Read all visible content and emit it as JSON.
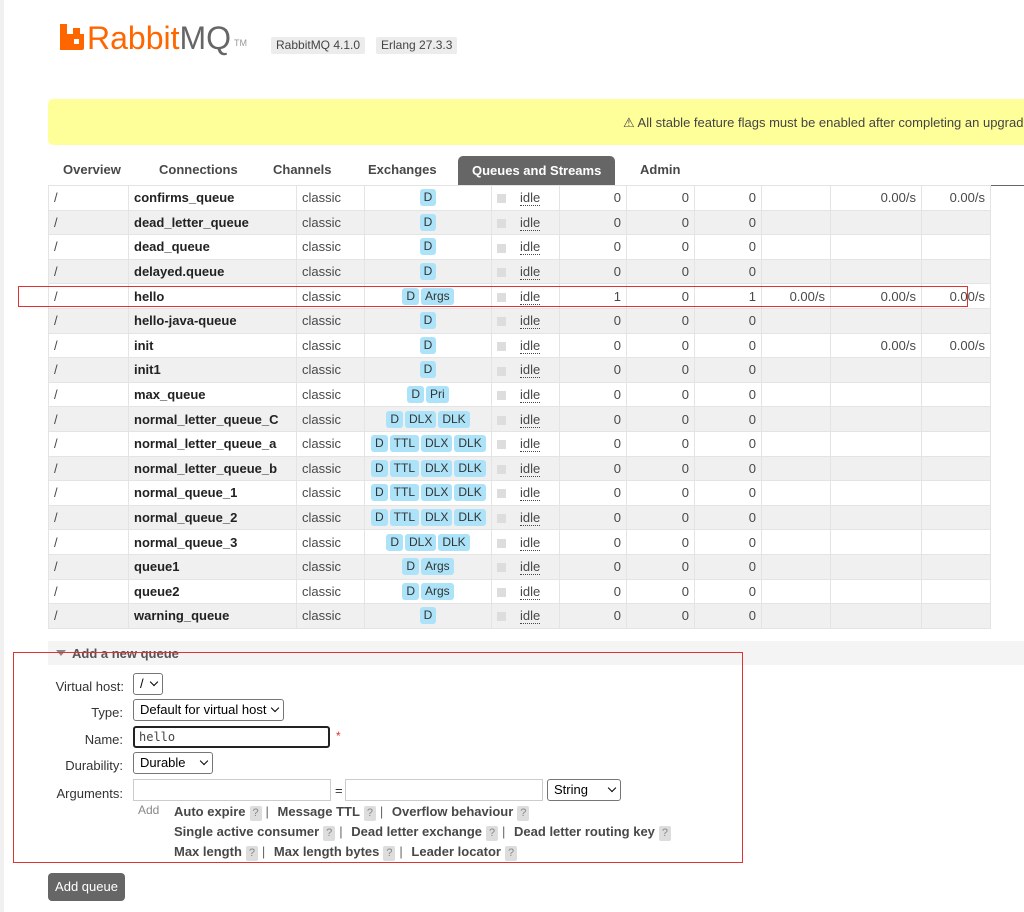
{
  "brand": {
    "name_part1": "Rabbit",
    "name_part2": "MQ",
    "tm": "TM"
  },
  "versions": [
    "RabbitMQ 4.1.0",
    "Erlang 27.3.3"
  ],
  "warning": {
    "text": "⚠ All stable feature flags must be enabled after completing an upgrade"
  },
  "tabs": [
    "Overview",
    "Connections",
    "Channels",
    "Exchanges",
    "Queues and Streams",
    "Admin"
  ],
  "active_tab": "Queues and Streams",
  "rows": [
    {
      "vhost": "/",
      "name": "confirms_queue",
      "type": "classic",
      "features": [
        "D"
      ],
      "state": "idle",
      "ready": "0",
      "unacked": "0",
      "total": "0",
      "incoming": "",
      "deliver": "0.00/s",
      "ack": "0.00/s"
    },
    {
      "vhost": "/",
      "name": "dead_letter_queue",
      "type": "classic",
      "features": [
        "D"
      ],
      "state": "idle",
      "ready": "0",
      "unacked": "0",
      "total": "0",
      "incoming": "",
      "deliver": "",
      "ack": ""
    },
    {
      "vhost": "/",
      "name": "dead_queue",
      "type": "classic",
      "features": [
        "D"
      ],
      "state": "idle",
      "ready": "0",
      "unacked": "0",
      "total": "0",
      "incoming": "",
      "deliver": "",
      "ack": ""
    },
    {
      "vhost": "/",
      "name": "delayed.queue",
      "type": "classic",
      "features": [
        "D"
      ],
      "state": "idle",
      "ready": "0",
      "unacked": "0",
      "total": "0",
      "incoming": "",
      "deliver": "",
      "ack": ""
    },
    {
      "vhost": "/",
      "name": "hello",
      "type": "classic",
      "features": [
        "D",
        "Args"
      ],
      "state": "idle",
      "ready": "1",
      "unacked": "0",
      "total": "1",
      "incoming": "0.00/s",
      "deliver": "0.00/s",
      "ack": "0.00/s"
    },
    {
      "vhost": "/",
      "name": "hello-java-queue",
      "type": "classic",
      "features": [
        "D"
      ],
      "state": "idle",
      "ready": "0",
      "unacked": "0",
      "total": "0",
      "incoming": "",
      "deliver": "",
      "ack": ""
    },
    {
      "vhost": "/",
      "name": "init",
      "type": "classic",
      "features": [
        "D"
      ],
      "state": "idle",
      "ready": "0",
      "unacked": "0",
      "total": "0",
      "incoming": "",
      "deliver": "0.00/s",
      "ack": "0.00/s"
    },
    {
      "vhost": "/",
      "name": "init1",
      "type": "classic",
      "features": [
        "D"
      ],
      "state": "idle",
      "ready": "0",
      "unacked": "0",
      "total": "0",
      "incoming": "",
      "deliver": "",
      "ack": ""
    },
    {
      "vhost": "/",
      "name": "max_queue",
      "type": "classic",
      "features": [
        "D",
        "Pri"
      ],
      "state": "idle",
      "ready": "0",
      "unacked": "0",
      "total": "0",
      "incoming": "",
      "deliver": "",
      "ack": ""
    },
    {
      "vhost": "/",
      "name": "normal_letter_queue_C",
      "type": "classic",
      "features": [
        "D",
        "DLX",
        "DLK"
      ],
      "state": "idle",
      "ready": "0",
      "unacked": "0",
      "total": "0",
      "incoming": "",
      "deliver": "",
      "ack": ""
    },
    {
      "vhost": "/",
      "name": "normal_letter_queue_a",
      "type": "classic",
      "features": [
        "D",
        "TTL",
        "DLX",
        "DLK"
      ],
      "state": "idle",
      "ready": "0",
      "unacked": "0",
      "total": "0",
      "incoming": "",
      "deliver": "",
      "ack": ""
    },
    {
      "vhost": "/",
      "name": "normal_letter_queue_b",
      "type": "classic",
      "features": [
        "D",
        "TTL",
        "DLX",
        "DLK"
      ],
      "state": "idle",
      "ready": "0",
      "unacked": "0",
      "total": "0",
      "incoming": "",
      "deliver": "",
      "ack": ""
    },
    {
      "vhost": "/",
      "name": "normal_queue_1",
      "type": "classic",
      "features": [
        "D",
        "TTL",
        "DLX",
        "DLK"
      ],
      "state": "idle",
      "ready": "0",
      "unacked": "0",
      "total": "0",
      "incoming": "",
      "deliver": "",
      "ack": ""
    },
    {
      "vhost": "/",
      "name": "normal_queue_2",
      "type": "classic",
      "features": [
        "D",
        "TTL",
        "DLX",
        "DLK"
      ],
      "state": "idle",
      "ready": "0",
      "unacked": "0",
      "total": "0",
      "incoming": "",
      "deliver": "",
      "ack": ""
    },
    {
      "vhost": "/",
      "name": "normal_queue_3",
      "type": "classic",
      "features": [
        "D",
        "DLX",
        "DLK"
      ],
      "state": "idle",
      "ready": "0",
      "unacked": "0",
      "total": "0",
      "incoming": "",
      "deliver": "",
      "ack": ""
    },
    {
      "vhost": "/",
      "name": "queue1",
      "type": "classic",
      "features": [
        "D",
        "Args"
      ],
      "state": "idle",
      "ready": "0",
      "unacked": "0",
      "total": "0",
      "incoming": "",
      "deliver": "",
      "ack": ""
    },
    {
      "vhost": "/",
      "name": "queue2",
      "type": "classic",
      "features": [
        "D",
        "Args"
      ],
      "state": "idle",
      "ready": "0",
      "unacked": "0",
      "total": "0",
      "incoming": "",
      "deliver": "",
      "ack": ""
    },
    {
      "vhost": "/",
      "name": "warning_queue",
      "type": "classic",
      "features": [
        "D"
      ],
      "state": "idle",
      "ready": "0",
      "unacked": "0",
      "total": "0",
      "incoming": "",
      "deliver": "",
      "ack": ""
    }
  ],
  "add_queue": {
    "section_title": "Add a new queue",
    "labels": {
      "vhost": "Virtual host:",
      "type": "Type:",
      "name": "Name:",
      "durability": "Durability:",
      "arguments": "Arguments:"
    },
    "vhost_value": "/",
    "type_value": "Default for virtual host",
    "name_value": "hello",
    "required_mark": "*",
    "durability_value": "Durable",
    "arg_equals": "=",
    "arg_type_value": "String",
    "add_label": "Add",
    "hints": [
      [
        "Auto expire",
        "Message TTL",
        "Overflow behaviour"
      ],
      [
        "Single active consumer",
        "Dead letter exchange",
        "Dead letter routing key"
      ],
      [
        "Max length",
        "Max length bytes",
        "Leader locator"
      ]
    ],
    "help_mark": "?",
    "separator": "|",
    "submit_label": "Add queue"
  }
}
